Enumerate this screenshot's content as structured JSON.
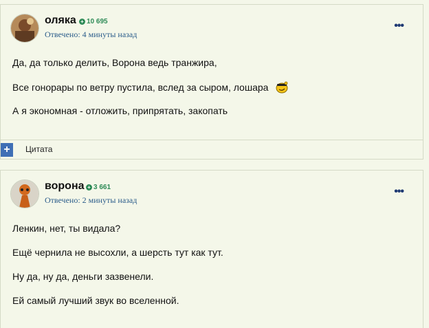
{
  "posts": [
    {
      "author": "оляка",
      "reputation": "10 695",
      "answered": "Отвечено: 4 минуты назад",
      "paragraphs": [
        "Да, да только делить, Ворона ведь транжира,",
        "Все гонорары по ветру пустила, вслед за сыром, лошара",
        "А я экономная - отложить, припрятать, закопать"
      ],
      "emoji_icon": "smirk-smiley-icon",
      "quote_label": "Цитата"
    },
    {
      "author": "ворона",
      "reputation": "3 661",
      "answered": "Отвечено: 2 минуты назад",
      "paragraphs": [
        "Ленкин, нет, ты видала?",
        "Ещё чернила не высохли, а шерсть тут как тут.",
        "Ну да, ну да, деньги зазвенели.",
        "Ей самый лучший звук во вселенной."
      ]
    }
  ],
  "icons": {
    "menu": "more-dots-icon",
    "plus": "plus-icon"
  },
  "colors": {
    "background": "#f4f7e9",
    "link": "#2b5c8a",
    "reputation": "#2e8b57",
    "accent": "#3f6fb5"
  }
}
